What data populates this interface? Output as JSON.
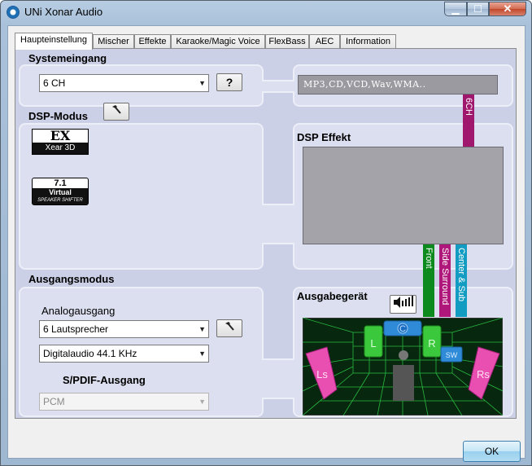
{
  "window": {
    "title": "UNi Xonar Audio",
    "min_glyph": "▁",
    "max_glyph": "☐",
    "close_glyph": "✕"
  },
  "tabs": [
    {
      "label": "Haupteinstellung",
      "active": true
    },
    {
      "label": "Mischer"
    },
    {
      "label": "Effekte"
    },
    {
      "label": "Karaoke/Magic Voice"
    },
    {
      "label": "FlexBass"
    },
    {
      "label": "AEC"
    },
    {
      "label": "Information"
    }
  ],
  "system_input": {
    "heading": "Systemeingang",
    "channel_value": "6 CH",
    "help_glyph": "?",
    "source_text": "MP3,CD,VCD,Wav,WMA.."
  },
  "dsp_mode": {
    "heading": "DSP-Modus",
    "logo_ex_big": "EX",
    "logo_ex_small": "Xear 3D",
    "logo_71_big": "7.1",
    "logo_71_mid": "Virtual",
    "logo_71_small": "SPEAKER SHIFTER"
  },
  "dsp_effect": {
    "heading": "DSP Effekt",
    "bar_6ch": "6CH",
    "bar_front": "Front",
    "bar_side": "Side Surround",
    "bar_center": "Center & Sub"
  },
  "output_mode": {
    "heading": "Ausgangsmodus",
    "analog_label": "Analogausgang",
    "speaker_value": "6 Lautsprecher",
    "digital_value": "Digitalaudio  44.1 KHz",
    "spdif_label": "S/PDIF-Ausgang",
    "spdif_value": "PCM"
  },
  "output_device": {
    "heading": "Ausgabegerät",
    "speaker_labels": {
      "L": "L",
      "C": "C",
      "R": "R",
      "SW": "SW",
      "Ls": "Ls",
      "Rs": "Rs"
    }
  },
  "footer": {
    "ok_label": "OK"
  },
  "colors": {
    "bar_6ch": "#a0186e",
    "bar_front": "#0c8a1e",
    "bar_side": "#b0177a",
    "bar_center": "#139cc2",
    "speaker_green": "#3cc83c",
    "speaker_pink": "#e84fb0",
    "speaker_blue": "#2f8bd8"
  }
}
